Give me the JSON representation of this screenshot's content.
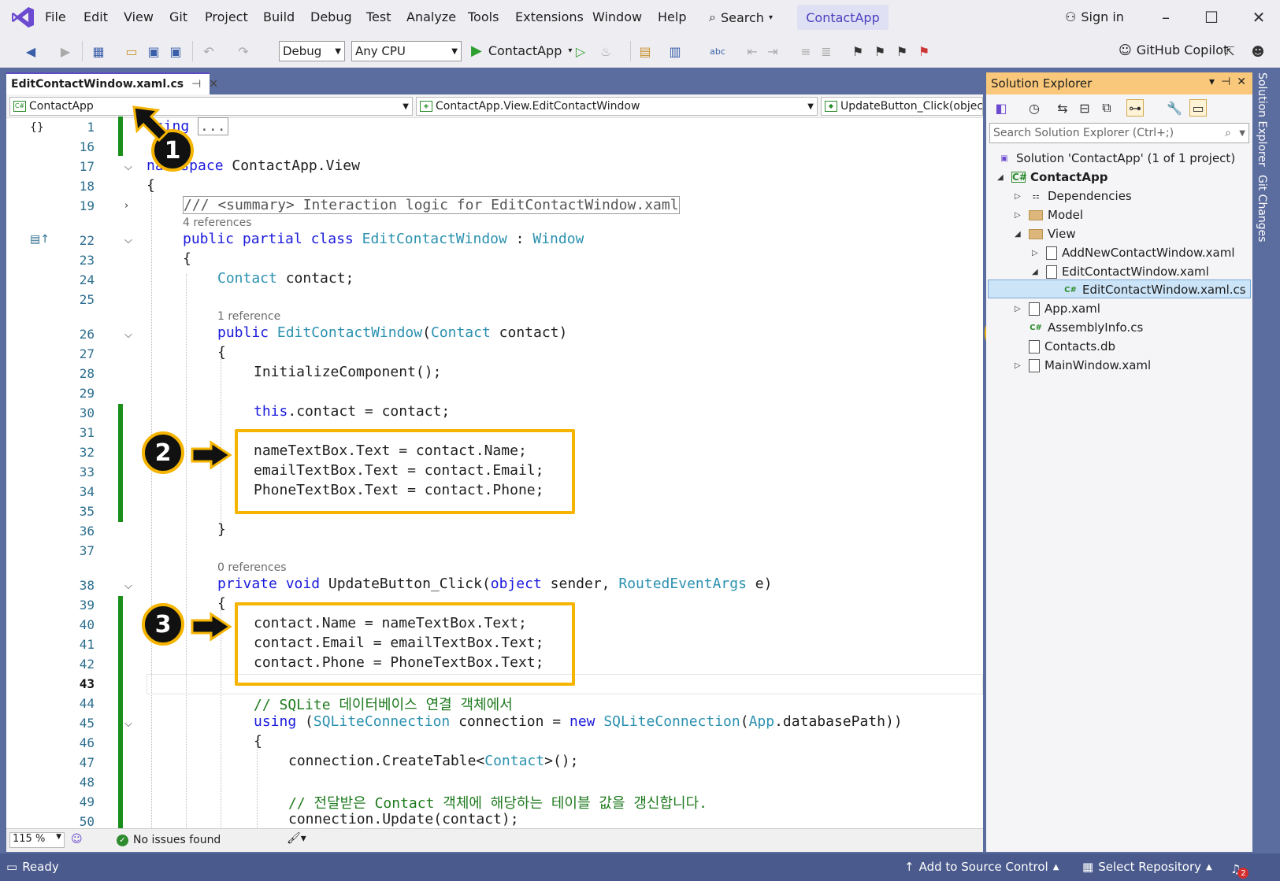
{
  "menu": {
    "items": [
      "File",
      "Edit",
      "View",
      "Git",
      "Project",
      "Build",
      "Debug",
      "Test",
      "Analyze",
      "Tools",
      "Extensions",
      "Window",
      "Help"
    ],
    "search_label": "Search",
    "app_name": "ContactApp",
    "sign_in": "Sign in"
  },
  "toolbar": {
    "config": "Debug",
    "platform": "Any CPU",
    "run_target": "ContactApp",
    "copilot": "GitHub Copilot"
  },
  "editor": {
    "tab_title": "EditContactWindow.xaml.cs",
    "nav_project": "ContactApp",
    "nav_class": "ContactApp.View.EditContactWindow",
    "nav_member": "UpdateButton_Click(objec",
    "zoom": "115 %",
    "issues": "No issues found",
    "line_numbers": [
      "1",
      "16",
      "17",
      "18",
      "19",
      "22",
      "23",
      "24",
      "25",
      "26",
      "27",
      "28",
      "29",
      "30",
      "31",
      "32",
      "33",
      "34",
      "35",
      "36",
      "37",
      "38",
      "39",
      "40",
      "41",
      "42",
      "43",
      "44",
      "45",
      "46",
      "47",
      "48",
      "49",
      "50"
    ],
    "lines": {
      "using": "using",
      "using_collapsed": "...",
      "ns_kw": "namespace",
      "ns_name": " ContactApp.View",
      "brace_open": "{",
      "brace_close": "}",
      "summary": "/// <summary> Interaction logic for EditContactWindow.xaml",
      "refs4": "4 references",
      "class_kw1": "public",
      "class_kw2": " partial",
      "class_kw3": " class",
      "class_name": " EditContactWindow",
      "class_colon": " : ",
      "class_base": "Window",
      "field_type": "Contact",
      "field_name": " contact;",
      "refs1": "1 reference",
      "ctor_kw": "public",
      "ctor_name": " EditContactWindow",
      "ctor_paren": "(",
      "ctor_ptype": "Contact",
      "ctor_pname": " contact)",
      "init": "InitializeComponent();",
      "this_kw": "this",
      "this_rest": ".contact = contact;",
      "set1": "nameTextBox.Text = contact.Name;",
      "set2": "emailTextBox.Text = contact.Email;",
      "set3": "PhoneTextBox.Text = contact.Phone;",
      "refs0": "0 references",
      "m_kw1": "private",
      "m_kw2": " void",
      "m_name": " UpdateButton_Click(",
      "m_obj": "object",
      "m_sender": " sender, ",
      "m_args": "RoutedEventArgs",
      "m_e": " e)",
      "get1": "contact.Name = nameTextBox.Text;",
      "get2": "contact.Email = emailTextBox.Text;",
      "get3": "contact.Phone = PhoneTextBox.Text;",
      "cm1": "// SQLite 데이터베이스 연결 객체에서",
      "using_kw": "using",
      "using_p": " (",
      "using_t1": "SQLiteConnection",
      "using_mid": " connection = ",
      "using_new": "new",
      "using_t2": " SQLiteConnection",
      "using_p2": "(",
      "using_app": "App",
      "using_end": ".databasePath))",
      "create1": "connection.CreateTable<",
      "create_t": "Contact",
      "create2": ">();",
      "cm2": "// 전달받은 Contact 객체에 해당하는 테이블 값을 갱신합니다.",
      "update": "connection.Update(contact);"
    }
  },
  "badges": [
    "1",
    "2",
    "3",
    "1"
  ],
  "solution_explorer": {
    "title": "Solution Explorer",
    "search_placeholder": "Search Solution Explorer (Ctrl+;)",
    "items": [
      {
        "label": "Solution 'ContactApp' (1 of 1 project)"
      },
      {
        "label": "ContactApp"
      },
      {
        "label": "Dependencies"
      },
      {
        "label": "Model"
      },
      {
        "label": "View"
      },
      {
        "label": "AddNewContactWindow.xaml"
      },
      {
        "label": "EditContactWindow.xaml"
      },
      {
        "label": "EditContactWindow.xaml.cs"
      },
      {
        "label": "App.xaml"
      },
      {
        "label": "AssemblyInfo.cs"
      },
      {
        "label": "Contacts.db"
      },
      {
        "label": "MainWindow.xaml"
      }
    ]
  },
  "side_tabs": [
    "Solution Explorer",
    "Git Changes"
  ],
  "status": {
    "ready": "Ready",
    "source_control": "Add to Source Control",
    "repository": "Select Repository",
    "notifications": "2"
  },
  "colors": {
    "accent": "#f5b400",
    "status_bar": "#4a5a8c",
    "keyword": "#1a1adc",
    "type": "#2b91af",
    "comment": "#1e7a1e"
  }
}
